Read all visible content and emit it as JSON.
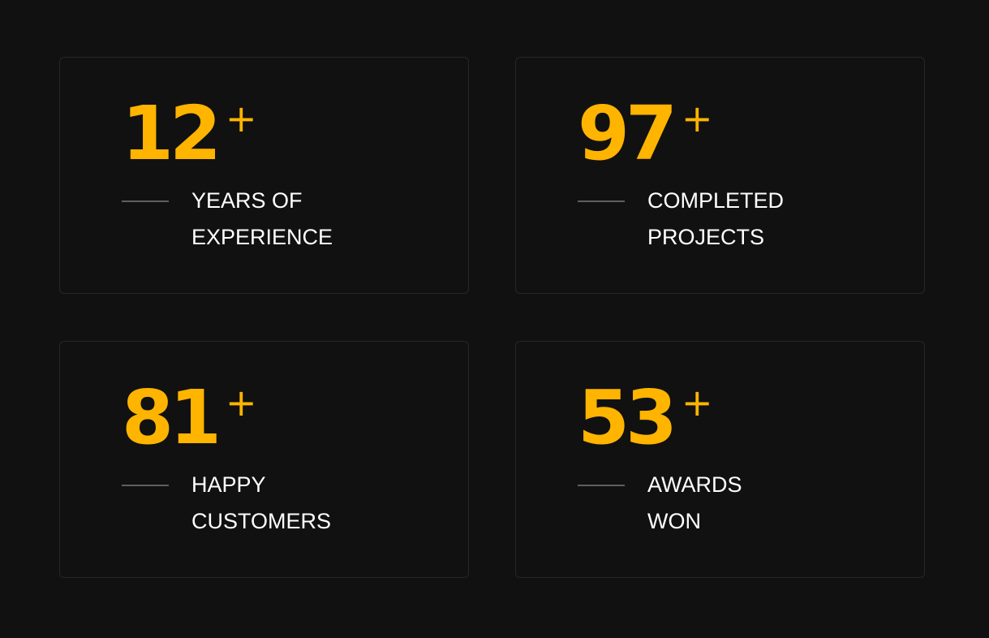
{
  "theme": {
    "background": "#111111",
    "card_border": "#272727",
    "accent": "#ffb400",
    "text": "#ffffff",
    "rule": "#5f5f5f"
  },
  "stats": [
    {
      "value": "12",
      "suffix": "+",
      "label_lines": [
        "YEARS OF",
        "EXPERIENCE"
      ]
    },
    {
      "value": "97",
      "suffix": "+",
      "label_lines": [
        "COMPLETED",
        "PROJECTS"
      ]
    },
    {
      "value": "81",
      "suffix": "+",
      "label_lines": [
        "HAPPY",
        "CUSTOMERS"
      ]
    },
    {
      "value": "53",
      "suffix": "+",
      "label_lines": [
        "AWARDS",
        "WON"
      ]
    }
  ]
}
